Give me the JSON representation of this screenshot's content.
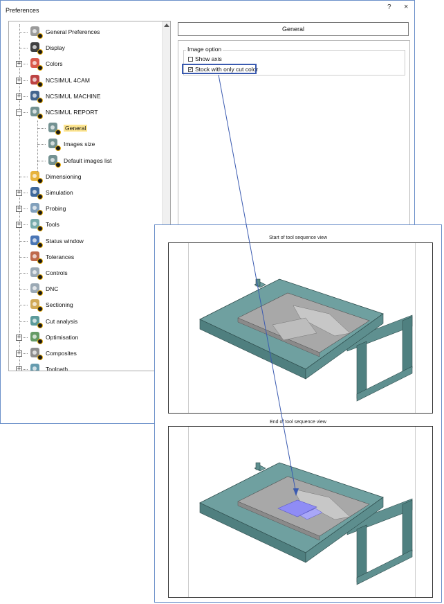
{
  "window": {
    "title": "Preferences",
    "help_label": "?",
    "close_label": "×"
  },
  "tree": {
    "items": [
      {
        "label": "General Preferences",
        "icon": "gear-icon",
        "expander": ""
      },
      {
        "label": "Display",
        "icon": "eye-icon",
        "expander": ""
      },
      {
        "label": "Colors",
        "icon": "colors-icon",
        "expander": "+"
      },
      {
        "label": "NCSIMUL 4CAM",
        "icon": "ncsimul-4cam-icon",
        "expander": "+"
      },
      {
        "label": "NCSIMUL MACHINE",
        "icon": "ncsimul-machine-icon",
        "expander": "+"
      },
      {
        "label": "NCSIMUL REPORT",
        "icon": "report-icon",
        "expander": "−"
      },
      {
        "label": "General",
        "icon": "report-general-icon",
        "expander": "",
        "selected": true
      },
      {
        "label": "Images size",
        "icon": "report-images-size-icon",
        "expander": ""
      },
      {
        "label": "Default images list",
        "icon": "report-images-list-icon",
        "expander": ""
      },
      {
        "label": "Dimensioning",
        "icon": "dimensioning-icon",
        "expander": ""
      },
      {
        "label": "Simulation",
        "icon": "simulation-icon",
        "expander": "+"
      },
      {
        "label": "Probing",
        "icon": "probing-icon",
        "expander": "+"
      },
      {
        "label": "Tools",
        "icon": "tools-icon",
        "expander": "+"
      },
      {
        "label": "Status window",
        "icon": "info-icon",
        "expander": ""
      },
      {
        "label": "Tolerances",
        "icon": "tolerances-icon",
        "expander": ""
      },
      {
        "label": "Controls",
        "icon": "controls-icon",
        "expander": ""
      },
      {
        "label": "DNC",
        "icon": "dnc-icon",
        "expander": ""
      },
      {
        "label": "Sectioning",
        "icon": "sectioning-icon",
        "expander": ""
      },
      {
        "label": "Cut analysis",
        "icon": "cut-analysis-icon",
        "expander": ""
      },
      {
        "label": "Optimisation",
        "icon": "optimisation-icon",
        "expander": "+"
      },
      {
        "label": "Composites",
        "icon": "composites-icon",
        "expander": "+"
      },
      {
        "label": "Toolpath",
        "icon": "toolpath-icon",
        "expander": "+"
      }
    ]
  },
  "panel": {
    "header": "General",
    "group_title": "Image option",
    "options": [
      {
        "label": "Show axis",
        "checked": false
      },
      {
        "label": "Stock with only cut color",
        "checked": true
      }
    ]
  },
  "preview": {
    "start_caption": "Start of tool sequence view",
    "end_caption": "End of tool sequence view"
  },
  "colors": {
    "stock": "#6fa0a0",
    "part": "#a7a7a7",
    "cut": "#8f8cf5",
    "accent": "#3a5ab0",
    "selection": "#fde590"
  }
}
